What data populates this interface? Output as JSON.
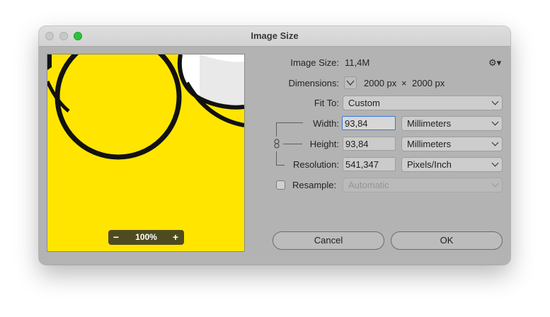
{
  "window": {
    "title": "Image Size"
  },
  "preview": {
    "zoom_level": "100%",
    "zoom_out_glyph": "−",
    "zoom_in_glyph": "+"
  },
  "image_size": {
    "label": "Image Size:",
    "value": "11,4M"
  },
  "settings": {
    "icon": "gear-icon"
  },
  "dimensions": {
    "label": "Dimensions:",
    "width": "2000 px",
    "times": "×",
    "height": "2000 px"
  },
  "fit_to": {
    "label": "Fit To:",
    "value": "Custom"
  },
  "width": {
    "label": "Width:",
    "value": "93,84",
    "unit": "Millimeters"
  },
  "height": {
    "label": "Height:",
    "value": "93,84",
    "unit": "Millimeters"
  },
  "resolution": {
    "label": "Resolution:",
    "value": "541,347",
    "unit": "Pixels/Inch"
  },
  "resample": {
    "label": "Resample:",
    "value": "Automatic",
    "checked": false
  },
  "buttons": {
    "cancel": "Cancel",
    "ok": "OK"
  },
  "colors": {
    "preview_yellow": "#ffe500",
    "focus_blue": "#3978d6",
    "zoom_green": "#2ac33c"
  }
}
